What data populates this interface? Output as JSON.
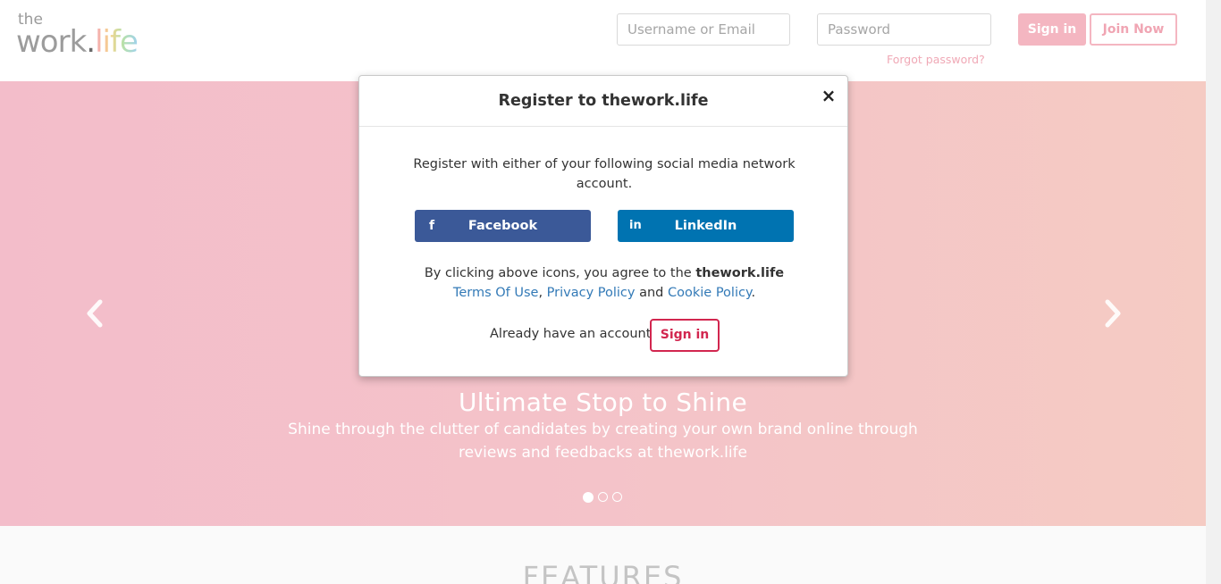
{
  "header": {
    "logo": {
      "the": "the",
      "work": "work",
      "dot": ".",
      "life": "life"
    },
    "username_placeholder": "Username or Email",
    "password_placeholder": "Password",
    "forgot_password": "Forgot password?",
    "signin_label": "Sign in",
    "join_label": "Join Now"
  },
  "hero": {
    "title": "Ultimate Stop to Shine",
    "subtitle": "Shine through the clutter of candidates by creating your own brand online through reviews and feedbacks at thework.life",
    "prev_icon": "chevron-left-icon",
    "next_icon": "chevron-right-icon",
    "slide_count": 3,
    "active_slide": 1
  },
  "features": {
    "title": "FEATURES"
  },
  "modal": {
    "title": "Register to thework.life",
    "close_icon": "close-icon",
    "description": "Register with either of your following social media network account.",
    "facebook_label": "Facebook",
    "facebook_icon": "facebook-icon",
    "linkedin_label": "LinkedIn",
    "linkedin_icon": "linkedin-icon",
    "agree_prefix": "By clicking above icons, you agree to the",
    "agree_brand": "thework.life",
    "terms_link": "Terms Of Use",
    "comma": ",",
    "privacy_link": "Privacy Policy",
    "and": "and",
    "cookie_link": "Cookie Policy",
    "period": ".",
    "already_text": "Already have an account?",
    "signin_label": "Sign in"
  },
  "colors": {
    "brand_pink": "#f4b6c1",
    "signin_red": "#d2264f",
    "facebook": "#3b5998",
    "linkedin": "#0073b1",
    "link": "#337ab7"
  }
}
